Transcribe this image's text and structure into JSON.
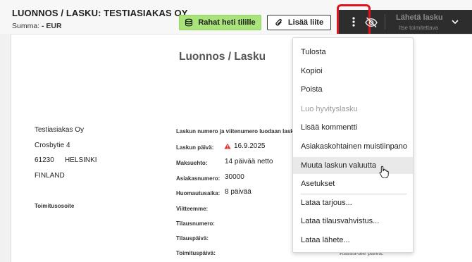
{
  "header": {
    "title": "LUONNOS / LASKU: TESTIASIAKAS OY",
    "summa_label": "Summa:",
    "summa_value": "- EUR",
    "money_button": "Rahat heti tilille",
    "attach_button": "Lisää liite",
    "send_button": "Lähetä lasku",
    "send_sub": "Itse toimitettava"
  },
  "document": {
    "title": "Luonnos / Lasku",
    "customer": {
      "name": "Testiasiakas Oy",
      "street": "Crosbytie 4",
      "postal_code": "61230",
      "city": "HELSINKI",
      "country": "FINLAND",
      "delivery_address_label": "Toimitusosoite"
    },
    "note": "Laskun numero ja viitenumero luodaan lasku",
    "fields": [
      {
        "label": "Laskun päivä:",
        "value": "16.9.2025"
      },
      {
        "label": "Maksuehto:",
        "value": "14 päivää netto"
      },
      {
        "label": "Asiakasnumero:",
        "value": "30000"
      },
      {
        "label": "Huomautusaika:",
        "value": "8 päivää"
      },
      {
        "label": "Viitteemme:",
        "value": ""
      },
      {
        "label": "Tilausnumero:",
        "value": ""
      },
      {
        "label": "Tilauspäivä:",
        "value": ""
      },
      {
        "label": "Toimituspäivä:",
        "value": ""
      }
    ],
    "partial_text": "Kassa-ale päivä:"
  },
  "menu": {
    "items": [
      {
        "label": "Tulosta",
        "disabled": false
      },
      {
        "label": "Kopioi",
        "disabled": false
      },
      {
        "label": "Poista",
        "disabled": false
      },
      {
        "label": "Luo hyvityslasku",
        "disabled": true
      },
      {
        "label": "Lisää kommentti",
        "disabled": false
      },
      {
        "label": "Asiakaskohtainen muistiinpano",
        "disabled": false
      },
      {
        "label": "Muuta laskun valuutta",
        "disabled": false,
        "hovered": true
      },
      {
        "label": "Asetukset",
        "disabled": false
      },
      {
        "label": "Lataa tarjous...",
        "disabled": false
      },
      {
        "label": "Lataa tilausvahvistus...",
        "disabled": false
      },
      {
        "label": "Lataa lähete...",
        "disabled": false
      }
    ]
  },
  "colors": {
    "accent_green": "#a9e47a",
    "highlight_red": "#e2131c",
    "dark_toolbar": "#2d2d2d",
    "warning": "#e0382f"
  },
  "icons": {
    "money": "money-stack-icon",
    "attach": "paperclip-icon",
    "kebab": "kebab-menu-icon",
    "visibility": "eye-off-icon",
    "dropdown": "chevron-down-icon",
    "warning": "warning-triangle-icon"
  }
}
